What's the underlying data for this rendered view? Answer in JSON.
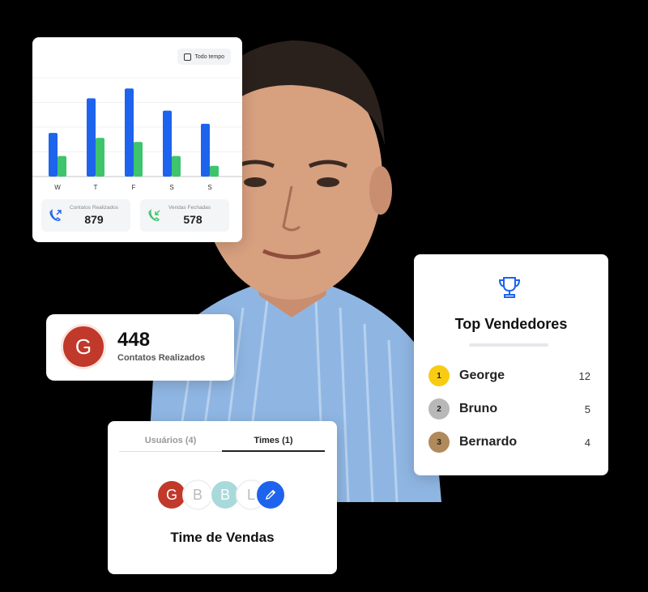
{
  "chart_card": {
    "period_label": "Todo tempo",
    "stats": [
      {
        "label": "Contatos Realizados",
        "value": "879"
      },
      {
        "label": "Vendas Fechadas",
        "value": "578"
      }
    ]
  },
  "chart_data": {
    "type": "bar",
    "categories": [
      "W",
      "T",
      "F",
      "S",
      "S"
    ],
    "series": [
      {
        "values": [
          53,
          95,
          107,
          80,
          64
        ],
        "color": "#1d63ed"
      },
      {
        "values": [
          25,
          47,
          42,
          25,
          13
        ],
        "color": "#3ec46d"
      }
    ],
    "ylim": [
      0,
      120
    ],
    "grid": true
  },
  "contact_badge": {
    "avatar_letter": "G",
    "count": "448",
    "label": "Contatos Realizados"
  },
  "top_sellers": {
    "title": "Top Vendedores",
    "icon": "trophy-icon",
    "rows": [
      {
        "rank": "1",
        "name": "George",
        "score": "12",
        "medal_color": "#f7cc13"
      },
      {
        "rank": "2",
        "name": "Bruno",
        "score": "5",
        "medal_color": "#b8b8b8"
      },
      {
        "rank": "3",
        "name": "Bernardo",
        "score": "4",
        "medal_color": "#b08a5a"
      }
    ]
  },
  "team_card": {
    "tabs": [
      {
        "label": "Usuários (4)",
        "active": false
      },
      {
        "label": "Times (1)",
        "active": true
      }
    ],
    "avatars": [
      {
        "letter": "G",
        "bg": "#c0392b",
        "fg": "#ffffff"
      },
      {
        "letter": "B",
        "bg": "#ffffff",
        "fg": "#bbbbbb"
      },
      {
        "letter": "B",
        "bg": "#a9dadb",
        "fg": "#ffffff"
      },
      {
        "letter": "L",
        "bg": "#ffffff",
        "fg": "#bbbbbb"
      }
    ],
    "edit_icon": "pencil-icon",
    "team_name": "Time de Vendas"
  },
  "colors": {
    "accent_blue": "#1d63ed",
    "accent_green": "#3ec46d"
  }
}
